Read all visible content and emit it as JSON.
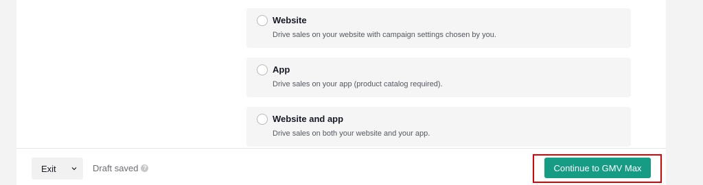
{
  "options": [
    {
      "title": "Website",
      "desc": "Drive sales on your website with campaign settings chosen by you."
    },
    {
      "title": "App",
      "desc": "Drive sales on your app (product catalog required)."
    },
    {
      "title": "Website and app",
      "desc": "Drive sales on both your website and your app."
    }
  ],
  "footer": {
    "exit_label": "Exit",
    "draft_status": "Draft saved",
    "continue_label": "Continue to GMV Max"
  },
  "colors": {
    "accent": "#169b85",
    "highlight": "#e00000"
  },
  "icons": {
    "exit_dropdown": "chevron-down-icon",
    "draft_info": "info-icon"
  }
}
